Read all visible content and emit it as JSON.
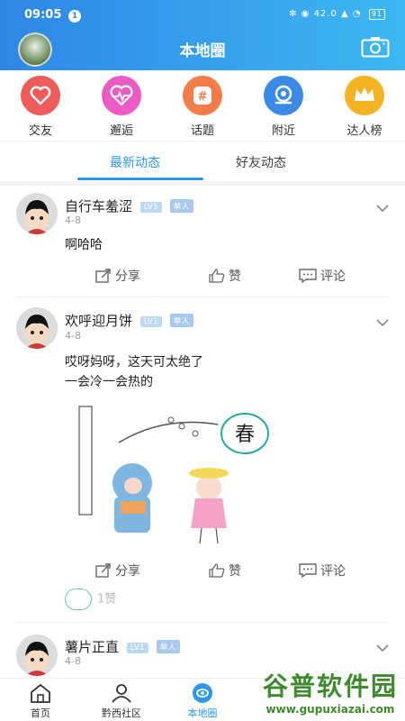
{
  "status": {
    "time": "09:05",
    "notif": "1",
    "right_icons": "✻ ◉ 42.0 ▲ ◔",
    "battery": "91"
  },
  "header": {
    "title": "本地圈"
  },
  "categories": [
    {
      "label": "交友",
      "icon": "heart-icon",
      "color": "#ee5b5b"
    },
    {
      "label": "邂逅",
      "icon": "pulse-heart-icon",
      "color": "#ea5cc4"
    },
    {
      "label": "话题",
      "icon": "hashtag-icon",
      "color": "#f37c4b"
    },
    {
      "label": "附近",
      "icon": "location-icon",
      "color": "#3b8ae6"
    },
    {
      "label": "达人榜",
      "icon": "crown-icon",
      "color": "#f3b322"
    }
  ],
  "tabs": [
    {
      "label": "最新动态",
      "active": true
    },
    {
      "label": "好友动态",
      "active": false
    }
  ],
  "posts": [
    {
      "name": "自行车羞涩",
      "level": "LV1",
      "tag": "单人",
      "date": "4-8",
      "text": [
        "啊哈哈"
      ]
    },
    {
      "name": "欢呼迎月饼",
      "level": "LV1",
      "tag": "单人",
      "date": "4-8",
      "text": [
        "哎呀妈呀，这天可太绝了",
        "一会冷一会热的"
      ],
      "image_caption": "春",
      "likes": "1赞"
    },
    {
      "name": "薯片正直",
      "level": "LV1",
      "tag": "单人",
      "date": "4-8"
    }
  ],
  "actions": {
    "share": "分享",
    "like": "赞",
    "comment": "评论"
  },
  "bottom_nav": [
    {
      "label": "首页",
      "icon": "home-icon"
    },
    {
      "label": "黔西社区",
      "icon": "community-icon"
    },
    {
      "label": "本地圈",
      "icon": "local-circle-icon",
      "active": true
    }
  ],
  "watermark": {
    "text": "谷普软件园",
    "url": "www.gupuxiazai.com"
  }
}
